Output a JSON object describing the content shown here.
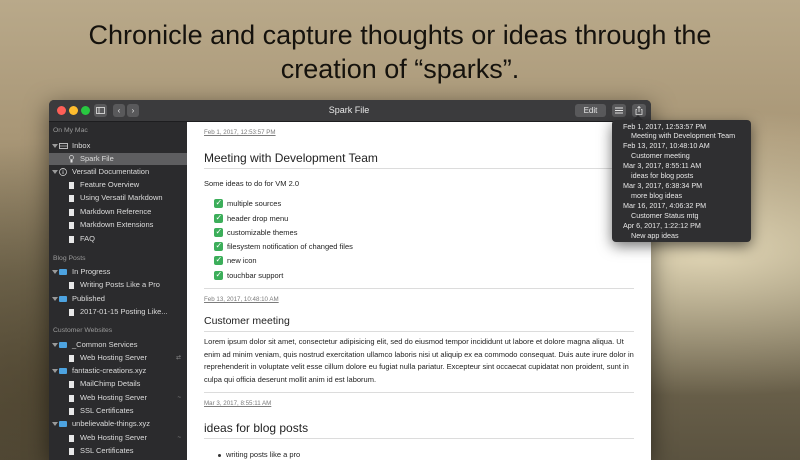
{
  "headline": {
    "line1": "Chronicle and capture thoughts or ideas through the",
    "line2": "creation of “sparks”."
  },
  "window": {
    "title": "Spark File",
    "edit_label": "Edit"
  },
  "sidebar": {
    "sections": {
      "on_my_mac": "On My Mac",
      "blog_posts": "Blog Posts",
      "customer_websites": "Customer Websites"
    },
    "items": {
      "inbox": "Inbox",
      "spark_file": "Spark File",
      "versatil_docs": "Versatil Documentation",
      "feature_overview": "Feature Overview",
      "using_markdown": "Using Versatil Markdown",
      "markdown_reference": "Markdown Reference",
      "markdown_extensions": "Markdown Extensions",
      "faq": "FAQ",
      "in_progress": "In Progress",
      "writing_posts": "Writing  Posts Like a Pro",
      "published": "Published",
      "published_post": "2017-01-15 Posting Like...",
      "common_services": "_Common Services",
      "web_hosting_1": "Web Hosting Server",
      "fantastic": "fantastic-creations.xyz",
      "mailchimp": "MailChimp Details",
      "web_hosting_2": "Web Hosting Server",
      "ssl_1": "SSL Certificates",
      "unbelievable": "unbelievable-things.xyz",
      "web_hosting_3": "Web Hosting Server",
      "ssl_2": "SSL Certificates"
    }
  },
  "editor": {
    "entry1": {
      "date": "Feb 1, 2017, 12:53:57 PM",
      "heading": "Meeting with Development Team",
      "intro": "Some ideas to do for VM 2.0",
      "checklist": [
        "multiple sources",
        "header drop menu",
        "customizable themes",
        "filesystem notification of changed files",
        "new icon",
        "touchbar support"
      ]
    },
    "entry2": {
      "date": "Feb 13, 2017, 10:48:10 AM",
      "heading": "Customer meeting",
      "body": "Lorem ipsum dolor sit amet, consectetur adipisicing elit, sed do eiusmod tempor incididunt ut labore et dolore magna aliqua. Ut enim ad minim veniam, quis nostrud exercitation ullamco laboris nisi ut aliquip ex ea commodo consequat. Duis aute irure dolor in reprehenderit in voluptate velit esse cillum dolore eu fugiat nulla pariatur. Excepteur sint occaecat cupidatat non proident, sunt in culpa qui officia deserunt mollit anim id est laborum."
    },
    "entry3": {
      "date": "Mar 3, 2017, 8:55:11 AM",
      "heading": "ideas for blog posts",
      "bullet1": "writing posts like a pro"
    }
  },
  "popover": {
    "entries": [
      {
        "date": "Feb 1, 2017, 12:53:57 PM",
        "title": "Meeting with Development Team"
      },
      {
        "date": "Feb 13, 2017, 10:48:10 AM",
        "title": "Customer meeting"
      },
      {
        "date": "Mar 3, 2017, 8:55:11 AM",
        "title": "ideas for blog posts"
      },
      {
        "date": "Mar 3, 2017, 6:38:34 PM",
        "title": "more blog ideas"
      },
      {
        "date": "Mar 16, 2017, 4:06:32 PM",
        "title": "Customer Status mtg"
      },
      {
        "date": "Apr 6, 2017, 1:22:12 PM",
        "title": "New app ideas"
      }
    ]
  },
  "colors": {
    "close": "#fe5f57",
    "minimize": "#febc2e",
    "zoom": "#28c840",
    "checkbox": "#3cae5a",
    "folder": "#4da3e0",
    "selection": "#5e5e60"
  }
}
